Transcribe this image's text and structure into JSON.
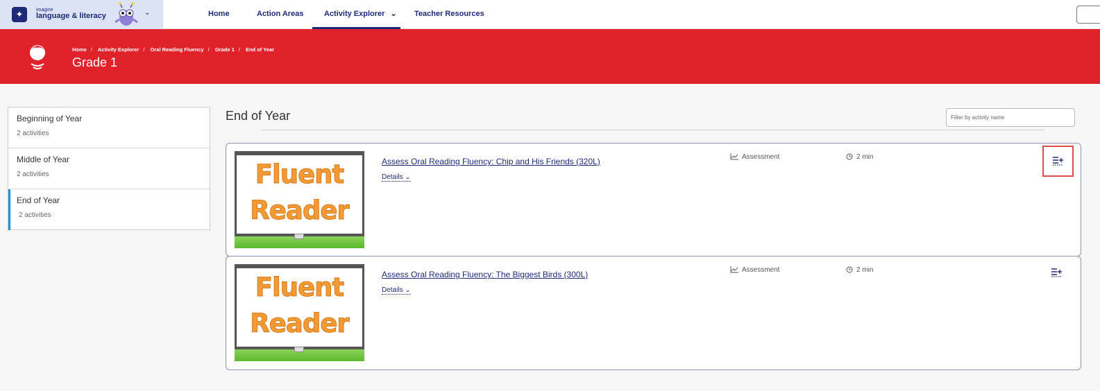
{
  "brand": {
    "small": "imagine",
    "name": "language & literacy",
    "badge_icon": "sparkle-icon"
  },
  "nav": {
    "links": [
      "Home",
      "Action Areas",
      "Activity Explorer",
      "Teacher Resources"
    ],
    "active": "Activity Explorer",
    "dropdown_symbol": "⌄"
  },
  "banner": {
    "color": "#e0222b",
    "breadcrumb": [
      "Home",
      "Activity Explorer",
      "Oral Reading Fluency",
      "Grade 1",
      "End of Year"
    ],
    "title": "Grade 1"
  },
  "sidebar": {
    "items": [
      {
        "label": "Beginning of Year",
        "count": "2 activities"
      },
      {
        "label": "Middle of Year",
        "count": "2 activities"
      },
      {
        "label": "End of Year",
        "count": "2 activities",
        "active": true
      }
    ]
  },
  "main": {
    "section_title": "End of Year",
    "filter_placeholder": "Filter by activity name",
    "activities": [
      {
        "title": "Assess Oral Reading Fluency: Chip and His Friends (320L)",
        "details_label": "Details",
        "type": "Assessment",
        "duration": "2 min",
        "thumb_line1": "Fluent",
        "thumb_line2": "Reader"
      },
      {
        "title": "Assess Oral Reading Fluency: The Biggest Birds (300L)",
        "details_label": "Details",
        "type": "Assessment",
        "duration": "2 min",
        "thumb_line1": "Fluent",
        "thumb_line2": "Reader"
      }
    ]
  }
}
